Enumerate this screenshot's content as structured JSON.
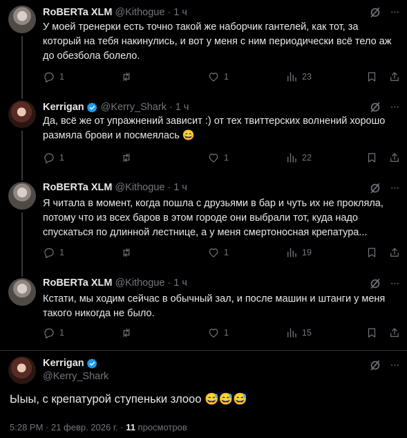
{
  "tweets": [
    {
      "name": "RoBERTa XLM",
      "handle": "@Kithogue",
      "time": "1 ч",
      "verified": false,
      "text": "У моей тренерки есть точно такой же наборчик гантелей, как тот, за который на тебя накинулись, и вот у меня с ним периодически всё тело аж до обезбола болело.",
      "replies": "1",
      "retweets": "",
      "likes": "1",
      "views": "23"
    },
    {
      "name": "Kerrigan",
      "handle": "@Kerry_Shark",
      "time": "1 ч",
      "verified": true,
      "text": "Да, всё же от упражнений зависит :) от тех твиттерских волнений хорошо размяла брови и посмеялась 😄",
      "replies": "1",
      "retweets": "",
      "likes": "1",
      "views": "22"
    },
    {
      "name": "RoBERTa XLM",
      "handle": "@Kithogue",
      "time": "1 ч",
      "verified": false,
      "text": "Я читала в момент, когда пошла с друзьями в бар и чуть их не прокляла, потому что из всех баров в этом городе они выбрали тот, куда надо спускаться по длинной лестнице, а у меня смертоносная крепатура...",
      "replies": "1",
      "retweets": "",
      "likes": "1",
      "views": "19"
    },
    {
      "name": "RoBERTa XLM",
      "handle": "@Kithogue",
      "time": "1 ч",
      "verified": false,
      "text": "Кстати, мы ходим сейчас в обычный зал, и после машин и штанги у меня такого никогда не было.",
      "replies": "1",
      "retweets": "",
      "likes": "1",
      "views": "15"
    }
  ],
  "main": {
    "name": "Kerrigan",
    "handle": "@Kerry_Shark",
    "text": "Ыыы, с крепатурой ступеньки злооо 😅😅😅",
    "timestamp": "5:28 PM · 21 февр. 2026 г. · ",
    "views_count": "11",
    "views_label": " просмотров"
  },
  "icons": {
    "reply": "reply-icon",
    "retweet": "retweet-icon",
    "like": "heart-icon",
    "views": "views-icon",
    "bookmark": "bookmark-icon",
    "share": "share-icon",
    "grok": "grok-icon",
    "more": "more-icon",
    "verified": "verified-badge-icon"
  },
  "colors": {
    "background": "#000000",
    "text": "#e7e9ea",
    "muted": "#71767b",
    "verified": "#1d9bf0",
    "divider": "#2f3336"
  }
}
